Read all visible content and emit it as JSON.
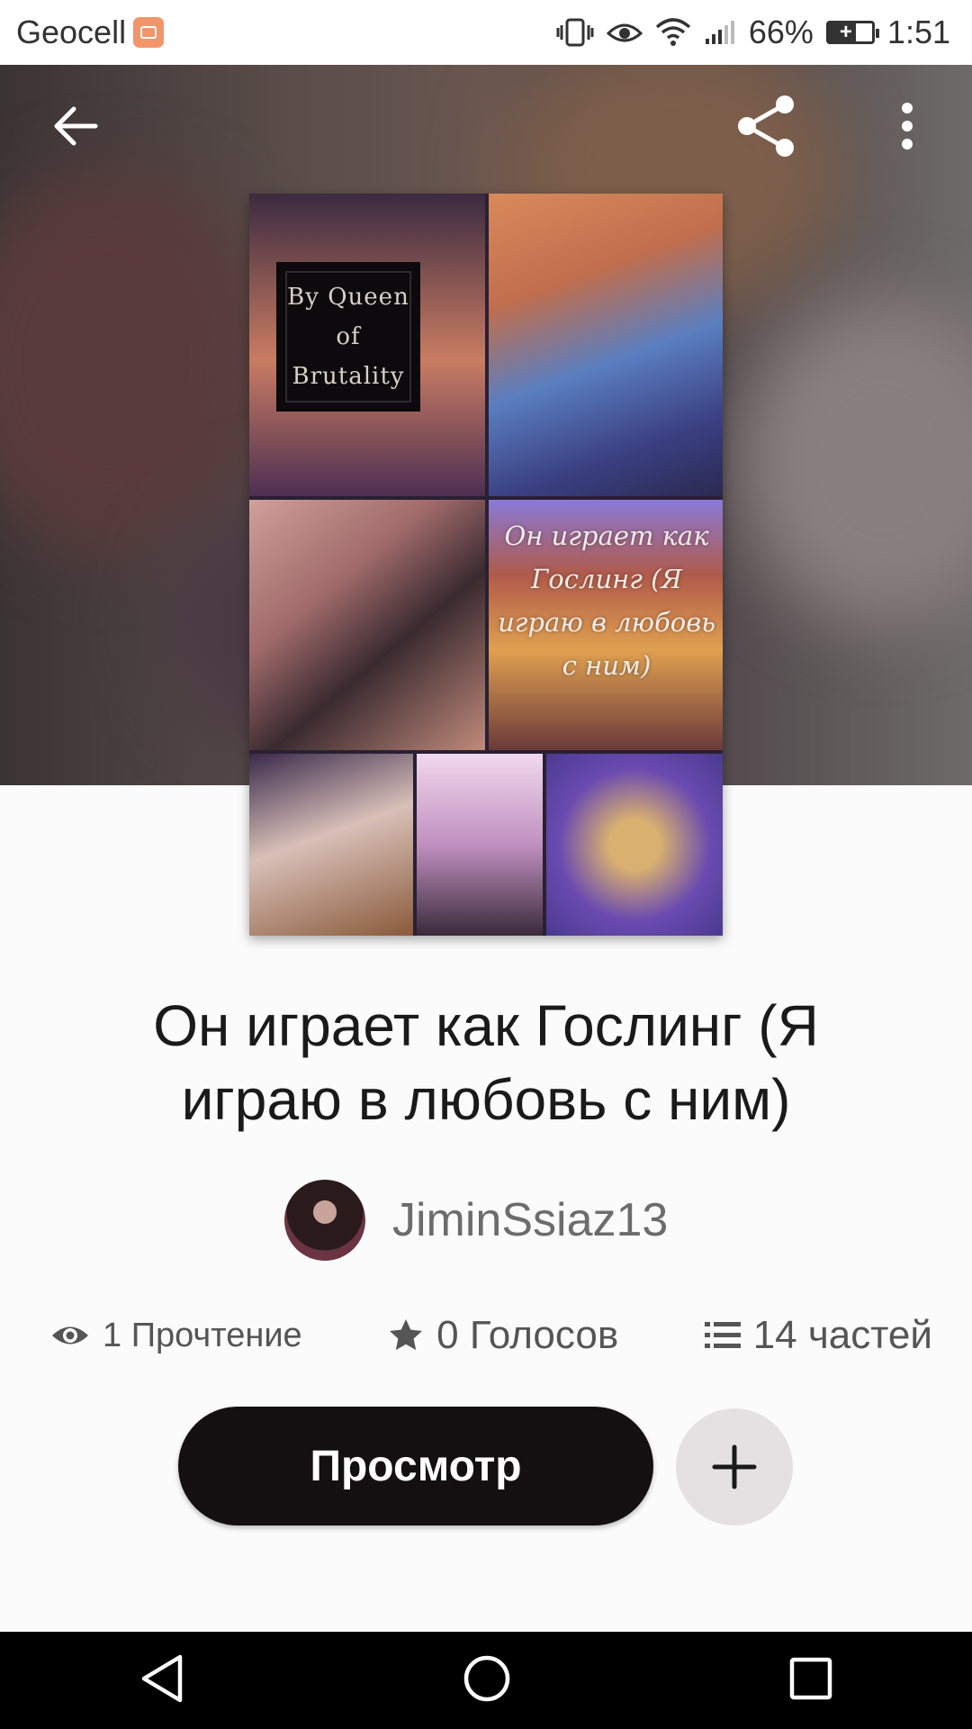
{
  "status_bar": {
    "carrier": "Geocell",
    "battery": "66%",
    "time": "1:51"
  },
  "toolbar": {
    "back_icon": "arrow-left-icon",
    "share_icon": "share-icon",
    "more_icon": "more-vertical-icon"
  },
  "cover": {
    "label_line1": "By Queen of",
    "label_line2": "Brutality",
    "script_text": "Он играет как Гослинг (Я играю в любовь с ним)"
  },
  "story": {
    "title": "Он играет как Гослинг (Я играю в любовь с ним)",
    "author": "JiminSsiaz13"
  },
  "stats": {
    "reads": "1 Прочтение",
    "votes": "0 Голосов",
    "parts": "14 частей"
  },
  "actions": {
    "read_label": "Просмотр",
    "add_icon": "plus-icon"
  },
  "nav": {
    "back": "nav-back-icon",
    "home": "nav-home-icon",
    "recents": "nav-recents-icon"
  },
  "colors": {
    "button_dark": "#121010",
    "add_button_bg": "#e3e1e1",
    "author_gray": "#6c6c6c"
  }
}
